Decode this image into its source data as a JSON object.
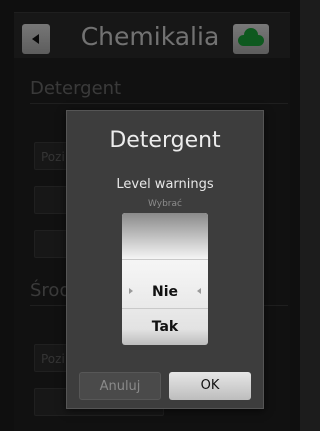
{
  "header": {
    "title": "Chemikalia"
  },
  "background": {
    "section1_title": "Detergent",
    "section1_field1": "Pozi",
    "section2_title": "Środ",
    "section2_field1": "Pozi"
  },
  "dialog": {
    "title": "Detergent",
    "subtitle": "Level warnings",
    "hint": "Wybrać",
    "options": [
      "Nie",
      "Tak"
    ],
    "selected": "Nie",
    "cancel_label": "Anuluj",
    "ok_label": "OK"
  },
  "colors": {
    "background": "#1c1c1c",
    "dialog": "#3d3d3d",
    "cloud_accent": "#1aa33a"
  }
}
